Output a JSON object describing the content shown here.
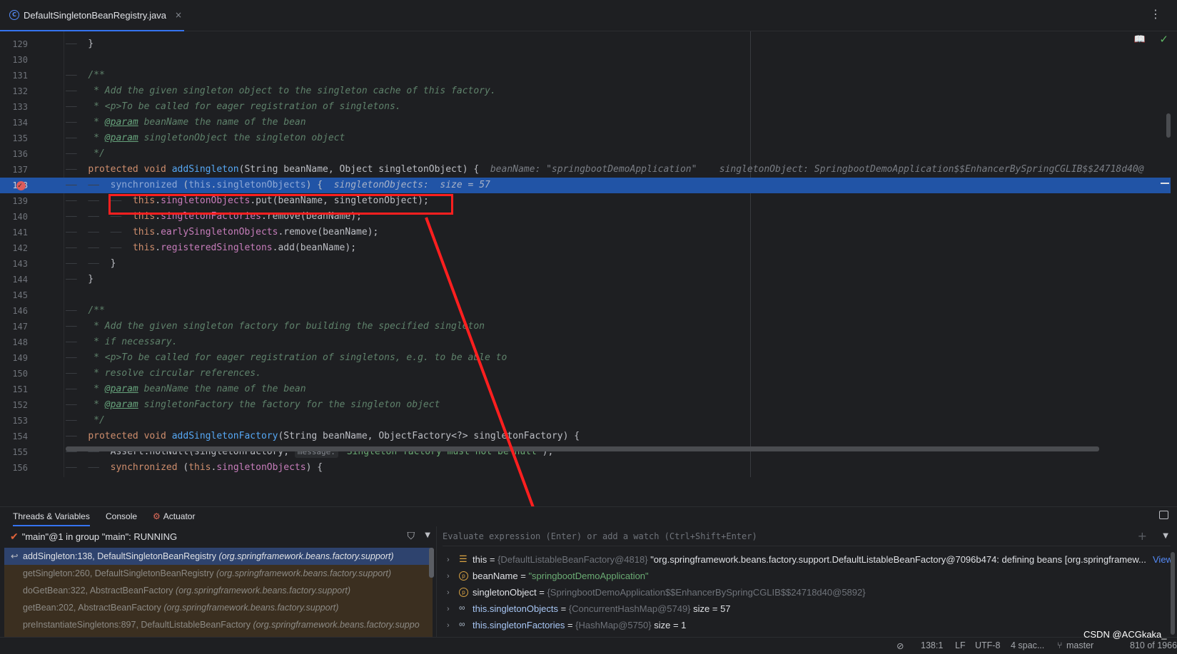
{
  "tab": {
    "file_name": "DefaultSingletonBeanRegistry.java",
    "close": "×",
    "more": "⋮"
  },
  "editor": {
    "lines": [
      {
        "num": "129",
        "indent": 1,
        "code": "}"
      },
      {
        "num": "130",
        "indent": 0,
        "code": ""
      },
      {
        "num": "131",
        "indent": 1,
        "code": "/**"
      },
      {
        "num": "132",
        "indent": 1,
        "code": " * Add the given singleton object to the singleton cache of this factory."
      },
      {
        "num": "133",
        "indent": 1,
        "code": " * <p>To be called for eager registration of singletons."
      },
      {
        "num": "134",
        "indent": 1,
        "tag": "@param",
        "pre": " * ",
        "code": " beanName the name of the bean"
      },
      {
        "num": "135",
        "indent": 1,
        "tag": "@param",
        "pre": " * ",
        "code": " singletonObject the singleton object"
      },
      {
        "num": "136",
        "indent": 1,
        "code": " */"
      },
      {
        "num": "137",
        "indent": 1,
        "kw": "protected void ",
        "fn": "addSingleton",
        "code": "(String beanName, Object singletonObject) {",
        "hint": "beanName: \"springbootDemoApplication\"    singletonObject: SpringbootDemoApplication$$EnhancerBySpringCGLIB$$24718d40@"
      },
      {
        "num": "138",
        "indent": 2,
        "kw": "synchronized ",
        "code": "(this.singletonObjects) {",
        "hint": "singletonObjects:  size = 57"
      },
      {
        "num": "139",
        "indent": 3,
        "code": "this.singletonObjects.put(beanName, singletonObject);"
      },
      {
        "num": "140",
        "indent": 3,
        "code": "this.singletonFactories.remove(beanName);"
      },
      {
        "num": "141",
        "indent": 3,
        "code": "this.earlySingletonObjects.remove(beanName);"
      },
      {
        "num": "142",
        "indent": 3,
        "code": "this.registeredSingletons.add(beanName);"
      },
      {
        "num": "143",
        "indent": 2,
        "code": "}"
      },
      {
        "num": "144",
        "indent": 1,
        "code": "}"
      },
      {
        "num": "145",
        "indent": 0,
        "code": ""
      },
      {
        "num": "146",
        "indent": 1,
        "code": "/**"
      },
      {
        "num": "147",
        "indent": 1,
        "code": " * Add the given singleton factory for building the specified singleton"
      },
      {
        "num": "148",
        "indent": 1,
        "code": " * if necessary."
      },
      {
        "num": "149",
        "indent": 1,
        "code": " * <p>To be called for eager registration of singletons, e.g. to be able to"
      },
      {
        "num": "150",
        "indent": 1,
        "code": " * resolve circular references."
      },
      {
        "num": "151",
        "indent": 1,
        "tag": "@param",
        "pre": " * ",
        "code": " beanName the name of the bean"
      },
      {
        "num": "152",
        "indent": 1,
        "tag": "@param",
        "pre": " * ",
        "code": " singletonFactory the factory for the singleton object"
      },
      {
        "num": "153",
        "indent": 1,
        "code": " */"
      },
      {
        "num": "154",
        "indent": 1,
        "kw": "protected void ",
        "fn": "addSingletonFactory",
        "code": "(String beanName, ObjectFactory<?> singletonFactory) {"
      },
      {
        "num": "155",
        "indent": 2,
        "code": "Assert.notNull(singletonFactory, ",
        "inlay": "message:",
        "str": "\"Singleton factory must not be null\"",
        "post": ");"
      },
      {
        "num": "156",
        "indent": 2,
        "kw": "synchronized ",
        "code": "(this.singletonObjects) {"
      }
    ]
  },
  "debug": {
    "tabs": [
      "Threads & Variables",
      "Console",
      "Actuator"
    ],
    "thread": "\"main\"@1 in group \"main\": RUNNING",
    "frames": [
      {
        "method": "addSingleton:138, DefaultSingletonBeanRegistry",
        "pkg": "(org.springframework.beans.factory.support)"
      },
      {
        "method": "getSingleton:260, DefaultSingletonBeanRegistry",
        "pkg": "(org.springframework.beans.factory.support)"
      },
      {
        "method": "doGetBean:322, AbstractBeanFactory",
        "pkg": "(org.springframework.beans.factory.support)"
      },
      {
        "method": "getBean:202, AbstractBeanFactory",
        "pkg": "(org.springframework.beans.factory.support)"
      },
      {
        "method": "preInstantiateSingletons:897, DefaultListableBeanFactory",
        "pkg": "(org.springframework.beans.factory.suppo"
      }
    ],
    "eval_placeholder": "Evaluate expression (Enter) or add a watch (Ctrl+Shift+Enter)",
    "variables": [
      {
        "name": "this",
        "eq": " = ",
        "type": "{DefaultListableBeanFactory@4818}",
        "value": " \"org.springframework.beans.factory.support.DefaultListableBeanFactory@7096b474: defining beans [org.springframew...",
        "link": "View"
      },
      {
        "name": "beanName",
        "eq": " = ",
        "str": "\"springbootDemoApplication\""
      },
      {
        "name": "singletonObject",
        "eq": " = ",
        "type": "{SpringbootDemoApplication$$EnhancerBySpringCGLIB$$24718d40@5892}"
      },
      {
        "name": "this.singletonObjects",
        "eq": " = ",
        "type": "{ConcurrentHashMap@5749}",
        "value": "  size = 57"
      },
      {
        "name": "this.singletonFactories",
        "eq": " = ",
        "type": "{HashMap@5750}",
        "value": "  size = 1"
      }
    ]
  },
  "status": {
    "position": "138:1",
    "line_sep": "LF",
    "encoding": "UTF-8",
    "indent": "4 spac...",
    "branch": "master",
    "memory": "810 of 1966"
  },
  "watermark": "CSDN @ACGkaka_",
  "colors": {
    "accent": "#3574f0",
    "highlight": "#ff1f1f",
    "exec_line": "#2154a6"
  }
}
